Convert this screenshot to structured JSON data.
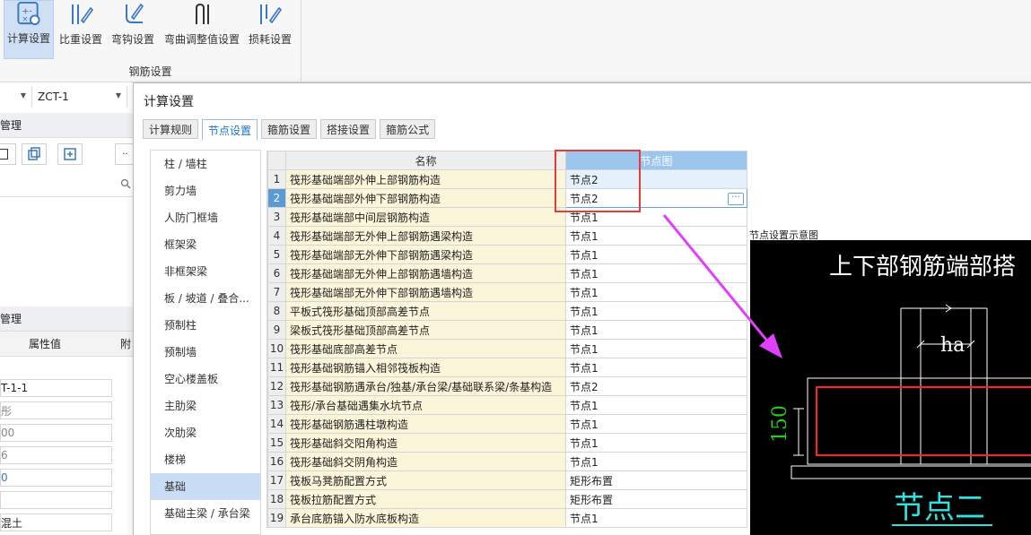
{
  "ribbon": {
    "buttons": [
      {
        "label": "计算设置",
        "icon": "calc-settings-icon",
        "active": true
      },
      {
        "label": "比重设置",
        "icon": "specific-gravity-icon"
      },
      {
        "label": "弯钩设置",
        "icon": "hook-settings-icon"
      },
      {
        "label": "弯曲调整值设置",
        "icon": "bend-adjust-icon"
      },
      {
        "label": "损耗设置",
        "icon": "loss-settings-icon"
      }
    ],
    "group_label": "钢筋设置"
  },
  "left_panel": {
    "combo2": "ZCT-1",
    "panel1_title": "管理",
    "panel2_title": "管理",
    "prop_header": "属性值",
    "prop_header_extra": "附",
    "prop_values": [
      "T-1-1",
      "彤",
      "00",
      "6",
      "0",
      "",
      "混土"
    ]
  },
  "dialog": {
    "title": "计算设置",
    "tabs": [
      "计算规则",
      "节点设置",
      "箍筋设置",
      "搭接设置",
      "箍筋公式"
    ],
    "active_tab": 1,
    "categories": [
      "柱 / 墙柱",
      "剪力墙",
      "人防门框墙",
      "框架梁",
      "非框架梁",
      "板 / 坡道 / 叠合...",
      "预制柱",
      "预制墙",
      "空心楼盖板",
      "主肋梁",
      "次肋梁",
      "楼梯",
      "基础",
      "基础主梁 / 承台梁"
    ],
    "active_category": 12,
    "table": {
      "headers": [
        "名称",
        "节点图"
      ],
      "rows": [
        {
          "no": "1",
          "name": "筏形基础端部外伸上部钢筋构造",
          "node": "节点2"
        },
        {
          "no": "2",
          "name": "筏形基础端部外伸下部钢筋构造",
          "node": "节点2"
        },
        {
          "no": "3",
          "name": "筏形基础端部中间层钢筋构造",
          "node": "节点1"
        },
        {
          "no": "4",
          "name": "筏形基础端部无外伸上部钢筋遇梁构造",
          "node": "节点1"
        },
        {
          "no": "5",
          "name": "筏形基础端部无外伸下部钢筋遇梁构造",
          "node": "节点1"
        },
        {
          "no": "6",
          "name": "筏形基础端部无外伸上部钢筋遇墙构造",
          "node": "节点1"
        },
        {
          "no": "7",
          "name": "筏形基础端部无外伸下部钢筋遇墙构造",
          "node": "节点1"
        },
        {
          "no": "8",
          "name": "平板式筏形基础顶部高差节点",
          "node": "节点1"
        },
        {
          "no": "9",
          "name": "梁板式筏形基础顶部高差节点",
          "node": "节点1"
        },
        {
          "no": "10",
          "name": "筏形基础底部高差节点",
          "node": "节点1"
        },
        {
          "no": "11",
          "name": "筏形基础钢筋锚入相邻筏板构造",
          "node": "节点1"
        },
        {
          "no": "12",
          "name": "筏形基础钢筋遇承台/独基/承台梁/基础联系梁/条基构造",
          "node": "节点2"
        },
        {
          "no": "13",
          "name": "筏形/承台基础遇集水坑节点",
          "node": "节点1"
        },
        {
          "no": "14",
          "name": "筏形基础钢筋遇柱墩构造",
          "node": "节点1"
        },
        {
          "no": "15",
          "name": "筏形基础斜交阳角构造",
          "node": "节点1"
        },
        {
          "no": "16",
          "name": "筏形基础斜交阴角构造",
          "node": "节点1"
        },
        {
          "no": "17",
          "name": "筏板马凳筋配置方式",
          "node": "矩形布置"
        },
        {
          "no": "18",
          "name": "筏板拉筋配置方式",
          "node": "矩形布置"
        },
        {
          "no": "19",
          "name": "承台底筋锚入防水底板构造",
          "node": "节点1"
        }
      ],
      "selected_row": 2
    },
    "preview": {
      "label": "节点设置示意图",
      "heading": "上下部钢筋端部搭",
      "dim_ha": "ha",
      "dim_150": "150",
      "caption": "节点二"
    }
  },
  "colors": {
    "accent": "#1a73c6",
    "highlight_box": "#e63b3b",
    "arrow": "#e040fb",
    "cad_green": "#22cc22",
    "cad_red": "#ff2222",
    "cad_cyan": "#33e0e0"
  }
}
